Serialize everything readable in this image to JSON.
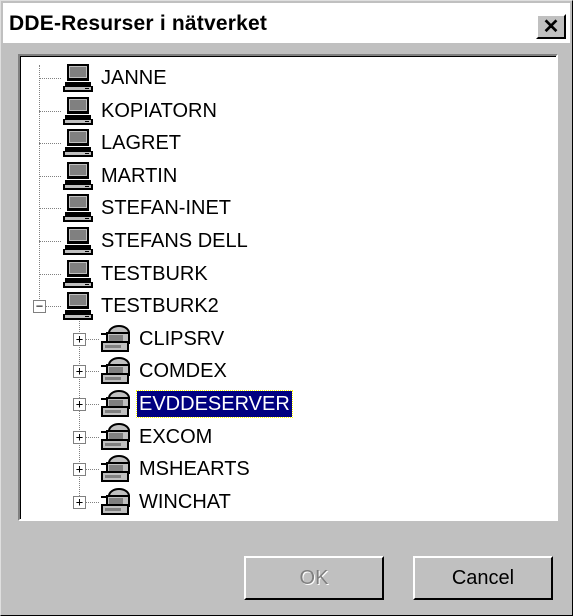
{
  "window": {
    "title": "DDE-Resurser i nätverket",
    "close_label": "✕"
  },
  "tree": {
    "computers": [
      {
        "label": "JANNE",
        "icon": "computer-icon"
      },
      {
        "label": "KOPIATORN",
        "icon": "computer-icon"
      },
      {
        "label": "LAGRET",
        "icon": "computer-icon"
      },
      {
        "label": "MARTIN",
        "icon": "computer-icon"
      },
      {
        "label": "STEFAN-INET",
        "icon": "computer-icon"
      },
      {
        "label": "STEFANS DELL",
        "icon": "computer-icon"
      },
      {
        "label": "TESTBURK",
        "icon": "computer-icon"
      },
      {
        "label": "TESTBURK2",
        "icon": "computer-icon",
        "expanded": true
      }
    ],
    "shares": [
      {
        "label": "CLIPSRV",
        "icon": "dde-server-icon"
      },
      {
        "label": "COMDEX",
        "icon": "dde-server-icon"
      },
      {
        "label": "EVDDESERVER",
        "icon": "dde-server-icon",
        "selected": true
      },
      {
        "label": "EXCOM",
        "icon": "dde-server-icon"
      },
      {
        "label": "MSHEARTS",
        "icon": "dde-server-icon"
      },
      {
        "label": "WINCHAT",
        "icon": "dde-server-icon"
      }
    ]
  },
  "buttons": {
    "ok": "OK",
    "cancel": "Cancel"
  },
  "colors": {
    "selection": "#000080",
    "face": "#c0c0c0"
  }
}
